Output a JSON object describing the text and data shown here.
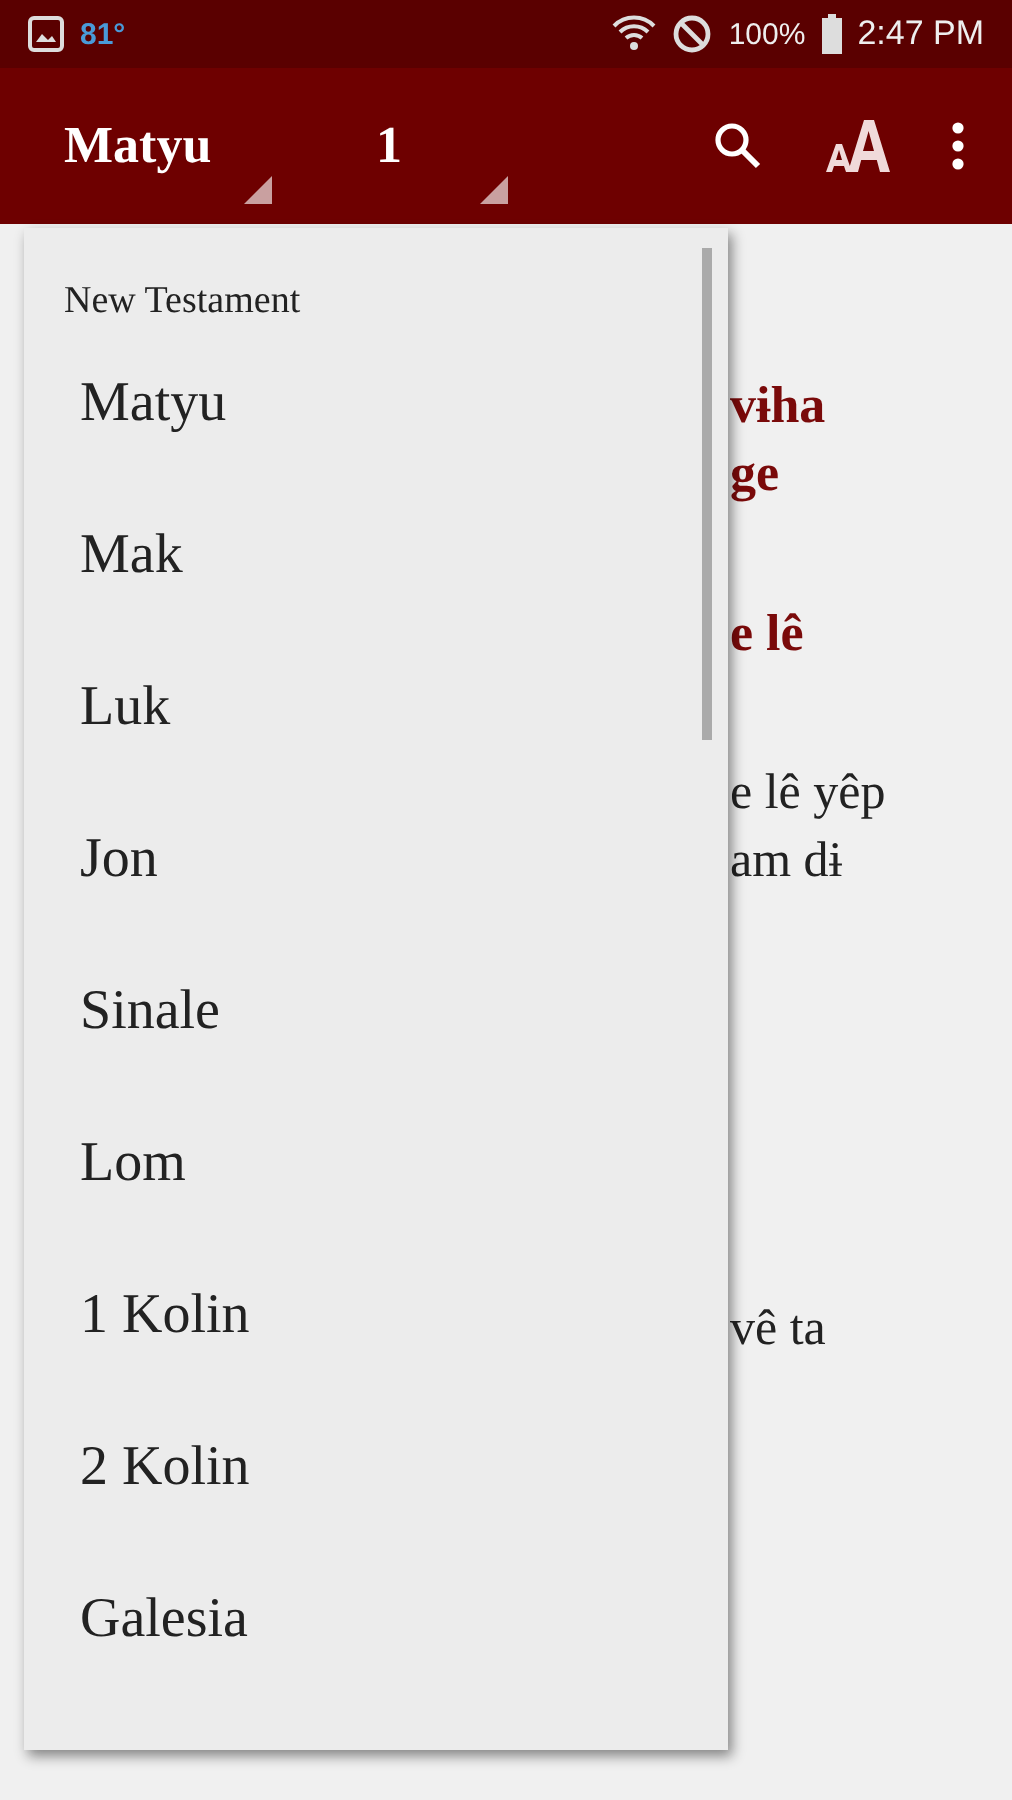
{
  "status_bar": {
    "temperature": "81°",
    "battery": "100%",
    "time": "2:47 PM"
  },
  "toolbar": {
    "book": "Matyu",
    "chapter": "1"
  },
  "content": {
    "lines": [
      {
        "kind": "heading",
        "text": "vɨha"
      },
      {
        "kind": "heading",
        "text": "ge"
      },
      {
        "kind": "heading",
        "text": "e lê"
      },
      {
        "kind": "verse",
        "text": "e lê yêp"
      },
      {
        "kind": "verse",
        "text": "am dɨ"
      },
      {
        "kind": "verse",
        "text": "vê ta"
      }
    ]
  },
  "dropdown": {
    "header": "New Testament",
    "items": [
      {
        "label": "Matyu"
      },
      {
        "label": "Mak"
      },
      {
        "label": "Luk"
      },
      {
        "label": "Jon"
      },
      {
        "label": "Sinale"
      },
      {
        "label": "Lom"
      },
      {
        "label": "1 Kolin"
      },
      {
        "label": "2 Kolin"
      },
      {
        "label": "Galesia"
      }
    ]
  }
}
